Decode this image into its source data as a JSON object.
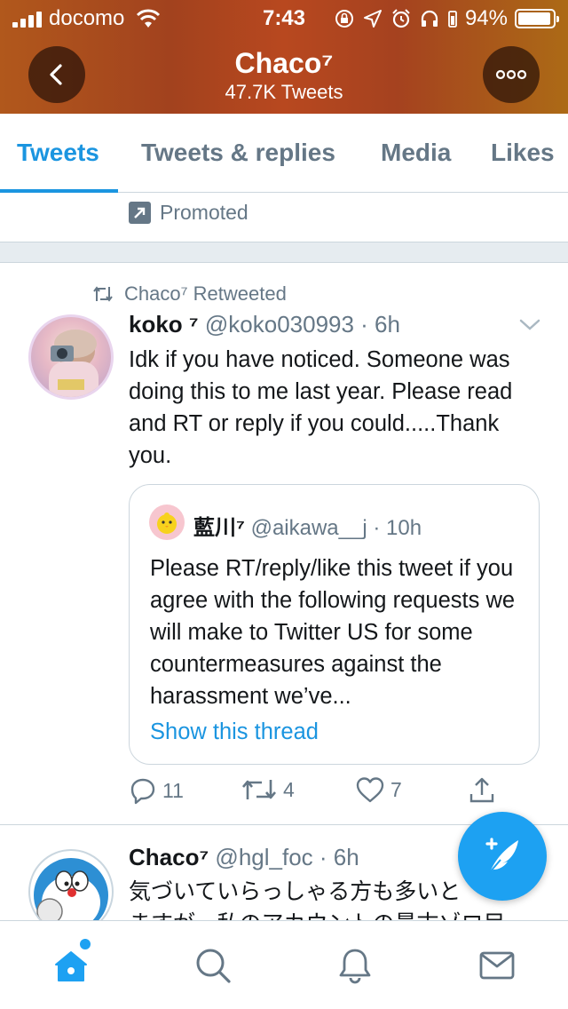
{
  "status_bar": {
    "carrier": "docomo",
    "time": "7:43",
    "battery_percent_label": "94%",
    "battery_level": 0.94
  },
  "header": {
    "profile_name": "Chaco⁷",
    "tweet_count": "47.7K Tweets",
    "back_icon": "chevron-left-icon",
    "more_icon": "more-horizontal-icon"
  },
  "tabs": [
    {
      "label": "Tweets",
      "active": true
    },
    {
      "label": "Tweets & replies",
      "active": false
    },
    {
      "label": "Media",
      "active": false
    },
    {
      "label": "Likes",
      "active": false
    }
  ],
  "promoted": {
    "label": "Promoted"
  },
  "tweets": [
    {
      "retweeted_by": "Chaco⁷ Retweeted",
      "name": "koko ⁷",
      "handle_time": "@koko030993 · 6h",
      "text": "Idk if you have noticed. Someone was doing this to me last year. Please read and RT or reply if you could.....Thank you.",
      "quote": {
        "name": "藍川⁷",
        "handle_time": "@aikawa__j · 10h",
        "text": "Please RT/reply/like this tweet if you agree with the following requests we will make to Twitter US for some countermeasures against the harassment we’ve...",
        "thread_link": "Show this thread"
      },
      "actions": {
        "replies": "11",
        "retweets": "4",
        "likes": "7"
      }
    },
    {
      "name": "Chaco⁷",
      "handle_time": "@hgl_foc · 6h",
      "text_line1": "気づいていらっしゃる方も多いと",
      "text_line2": "ますが、私のアカウントの最古ゾロ目"
    }
  ],
  "colors": {
    "accent": "#1da1f2",
    "tab_active": "#1b95e0",
    "muted": "#657786"
  },
  "bottom_nav": [
    "home-icon",
    "search-icon",
    "notifications-icon",
    "messages-icon"
  ]
}
